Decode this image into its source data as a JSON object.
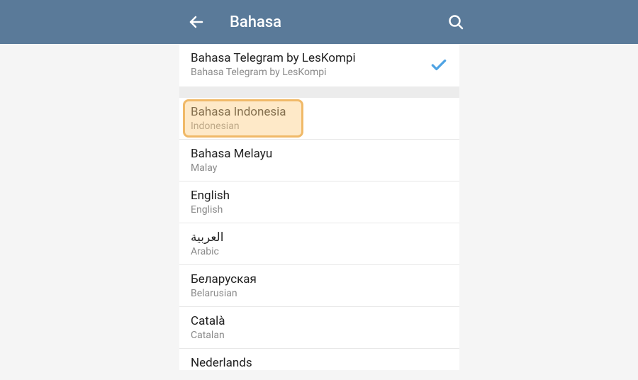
{
  "header": {
    "title": "Bahasa"
  },
  "current": {
    "title": "Bahasa Telegram by LesKompi",
    "subtitle": "Bahasa Telegram by LesKompi"
  },
  "languages": [
    {
      "title": "Bahasa Indonesia",
      "subtitle": "Indonesian",
      "highlighted": true
    },
    {
      "title": "Bahasa Melayu",
      "subtitle": "Malay",
      "highlighted": false
    },
    {
      "title": "English",
      "subtitle": "English",
      "highlighted": false
    },
    {
      "title": "العربية",
      "subtitle": "Arabic",
      "highlighted": false
    },
    {
      "title": "Беларуская",
      "subtitle": "Belarusian",
      "highlighted": false
    },
    {
      "title": "Català",
      "subtitle": "Catalan",
      "highlighted": false
    }
  ],
  "cutoff": {
    "title": "Nederlands"
  }
}
